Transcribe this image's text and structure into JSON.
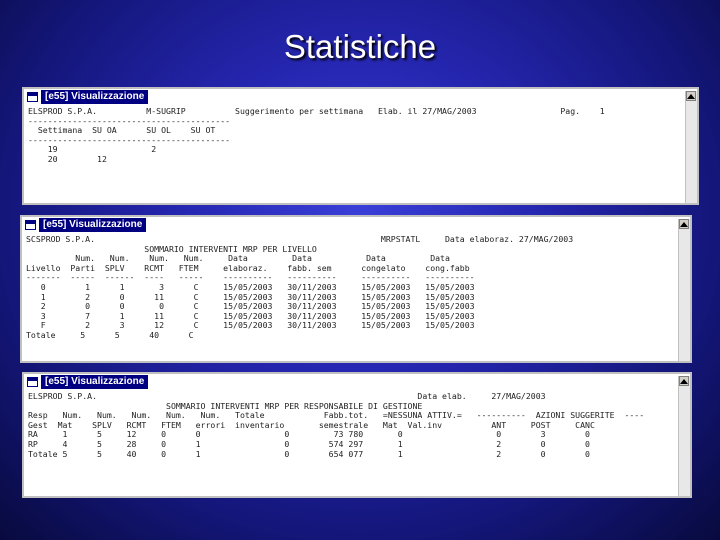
{
  "slide": {
    "title": "Statistiche"
  },
  "windows": [
    {
      "title": "[e55] Visualizzazione",
      "lines": [
        "ELSPROD S.P.A.          M-SUGRIP          Suggerimento per settimana   Elab. il 27/MAG/2003                 Pag.    1",
        "-----------------------------------------",
        "  Settimana  SU OA      SU OL    SU OT",
        "-----------------------------------------",
        "    19                   2",
        "    20        12"
      ]
    },
    {
      "title": "[e55] Visualizzazione",
      "lines": [
        "SCSPROD S.P.A.                                                          MRPSTATL     Data elaboraz. 27/MAG/2003",
        "                        SOMMARIO INTERVENTI MRP PER LIVELLO",
        "          Num.   Num.    Num.   Num.     Data         Data           Data         Data",
        "Livello  Parti  SPLV    RCMT   FTEM     elaboraz.    fabb. sem      congelato    cong.fabb",
        "-------  -----  ------  ----   -----    ----------   ----------     ----------   ----------",
        "   0        1      1       3      C     15/05/2003   30/11/2003     15/05/2003   15/05/2003",
        "   1        2      0      11      C     15/05/2003   30/11/2003     15/05/2003   15/05/2003",
        "   2        0      0       0      C     15/05/2003   30/11/2003     15/05/2003   15/05/2003",
        "   3        7      1      11      C     15/05/2003   30/11/2003     15/05/2003   15/05/2003",
        "   F        2      3      12      C     15/05/2003   30/11/2003     15/05/2003   15/05/2003",
        "Totale     5      5      40      C"
      ]
    },
    {
      "title": "[e55] Visualizzazione",
      "lines": [
        "ELSPROD S.P.A.                                                                 Data elab.     27/MAG/2003",
        "                            SOMMARIO INTERVENTI MRP PER RESPONSABILE DI GESTIONE",
        "Resp   Num.   Num.   Num.   Num.   Num.   Totale            Fabb.tot.   =NESSUNA ATTIV.=   ----------  AZIONI SUGGERITE  ----",
        "Gest  Mat    SPLV   RCMT   FTEM   errori  inventario       semestrale   Mat  Val.inv          ANT     POST     CANC",
        "",
        "RA     1      5     12     0      0                 0         73 780       0                   0        3        0",
        "RP     4      5     28     0      1                 0        574 297       1                   2        0        0",
        "Totale 5      5     40     0      1                 0        654 077       1                   2        0        0"
      ]
    }
  ]
}
